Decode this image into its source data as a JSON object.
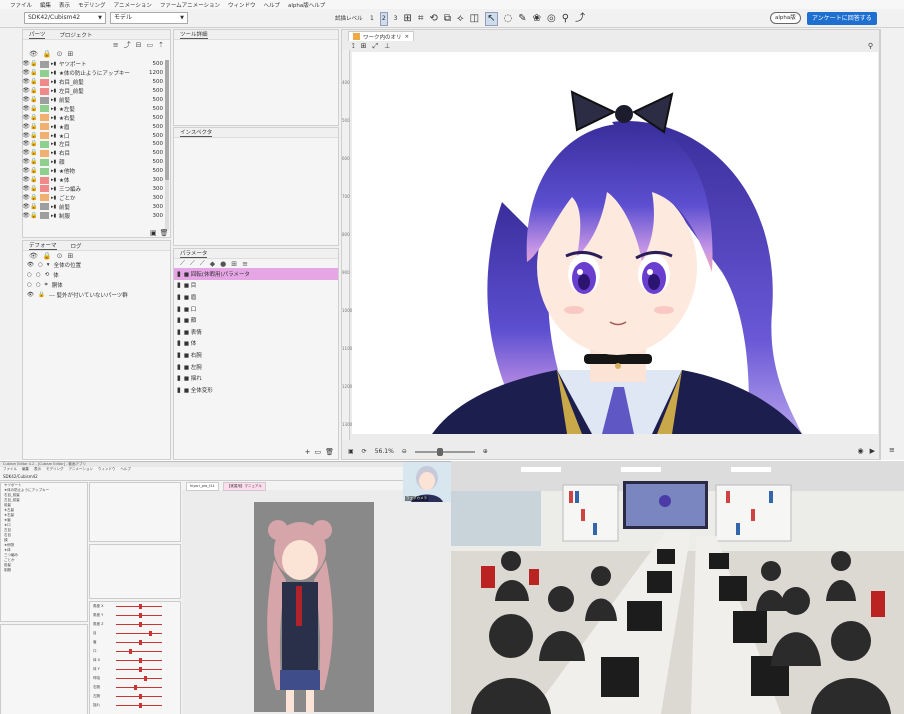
{
  "menu": [
    "ファイル",
    "編集",
    "表示",
    "モデリング",
    "アニメーション",
    "ファームアニメーション",
    "ウィンドウ",
    "ヘルプ",
    "alpha版ヘルプ"
  ],
  "toolbar": {
    "project_select": "SDK42/Cubism42",
    "mode_select": "モデル",
    "mode_label": "試描レベル",
    "level_numbers": [
      "1",
      "2",
      "3"
    ],
    "alpha_pill": "alpha版",
    "survey_button": "アンケートに回答する"
  },
  "parts_panel": {
    "tabs": [
      "パーツ",
      "プロジェクト"
    ],
    "items": [
      {
        "name": "ヤツポート",
        "value": "500",
        "color": "#9e9e9e"
      },
      {
        "name": "★体の防止ようにアップキー",
        "value": "1200",
        "color": "#8fd08f"
      },
      {
        "name": "右目_前髪",
        "value": "500",
        "color": "#f08a8a"
      },
      {
        "name": "左目_前髪",
        "value": "500",
        "color": "#f08a8a"
      },
      {
        "name": "前髪",
        "value": "500",
        "color": "#9e9e9e"
      },
      {
        "name": "★左髪",
        "value": "500",
        "color": "#8fd08f"
      },
      {
        "name": "★右髪",
        "value": "500",
        "color": "#f0b070"
      },
      {
        "name": "★眉",
        "value": "500",
        "color": "#f0b070"
      },
      {
        "name": "★口",
        "value": "500",
        "color": "#f0b070"
      },
      {
        "name": "左目",
        "value": "500",
        "color": "#8fd08f"
      },
      {
        "name": "右目",
        "value": "500",
        "color": "#f0b070"
      },
      {
        "name": "顔",
        "value": "500",
        "color": "#8fd08f"
      },
      {
        "name": "★他物",
        "value": "500",
        "color": "#8fd08f"
      },
      {
        "name": "★体",
        "value": "300",
        "color": "#f08a8a"
      },
      {
        "name": "三つ編み",
        "value": "300",
        "color": "#f08a8a"
      },
      {
        "name": "ごとか",
        "value": "300",
        "color": "#f0b070"
      },
      {
        "name": "前髪",
        "value": "300",
        "color": "#9e9e9e"
      },
      {
        "name": "制服",
        "value": "300",
        "color": "#9e9e9e"
      }
    ]
  },
  "tool_details": {
    "title": "ツール詳細"
  },
  "inspector": {
    "title": "インスペクタ"
  },
  "deformer_panel": {
    "tabs": [
      "デフォーマ",
      "ログ"
    ],
    "items": [
      "全体の位置",
      "体",
      "胴体",
      "--- 髪外が付いていないパーツ群"
    ]
  },
  "param_panel": {
    "title": "パラメータ",
    "items": [
      "■ 回転(休暇用)パラメータ",
      "■ 目",
      "■ 眉",
      "■ 口",
      "■ 顔",
      "■ 表情",
      "■ 体",
      "■ 右腕",
      "■ 左腕",
      "■ 揺れ",
      "■ 全体変形"
    ]
  },
  "canvas": {
    "tab": "ワーク内のオリ",
    "zoom": "56.1%",
    "ruler_ticks": [
      "400",
      "500",
      "600",
      "700",
      "800",
      "900",
      "1000",
      "1100",
      "1200",
      "1300"
    ]
  },
  "screenshot2": {
    "title": "Cubism Editor 4.2 - [Cubism Editor] - 動画アプリ",
    "menu": [
      "ファイル",
      "編集",
      "表示",
      "モデリング",
      "アニメーション",
      "ウィンドウ",
      "ヘルプ"
    ],
    "toolbar": "SDK42/Cubism42",
    "tabs": [
      "hiyori_pro_t11",
      "【実習用】マニュアル"
    ],
    "sliders": [
      {
        "label": "角度 X",
        "pos": 0.5
      },
      {
        "label": "角度 Y",
        "pos": 0.5
      },
      {
        "label": "角度 Z",
        "pos": 0.5
      },
      {
        "label": "目",
        "pos": 0.7
      },
      {
        "label": "眉",
        "pos": 0.5
      },
      {
        "label": "口",
        "pos": 0.3
      },
      {
        "label": "体 X",
        "pos": 0.5
      },
      {
        "label": "体 Y",
        "pos": 0.5
      },
      {
        "label": "呼吸",
        "pos": 0.6
      },
      {
        "label": "右腕",
        "pos": 0.4
      },
      {
        "label": "左腕",
        "pos": 0.5
      },
      {
        "label": "揺れ",
        "pos": 0.5
      }
    ],
    "webcam_label": "ウェブカメラ"
  },
  "colors": {
    "accent": "#1f6fd1",
    "selected_param": "#e6a6e6",
    "hair": "#4b3ba6"
  }
}
